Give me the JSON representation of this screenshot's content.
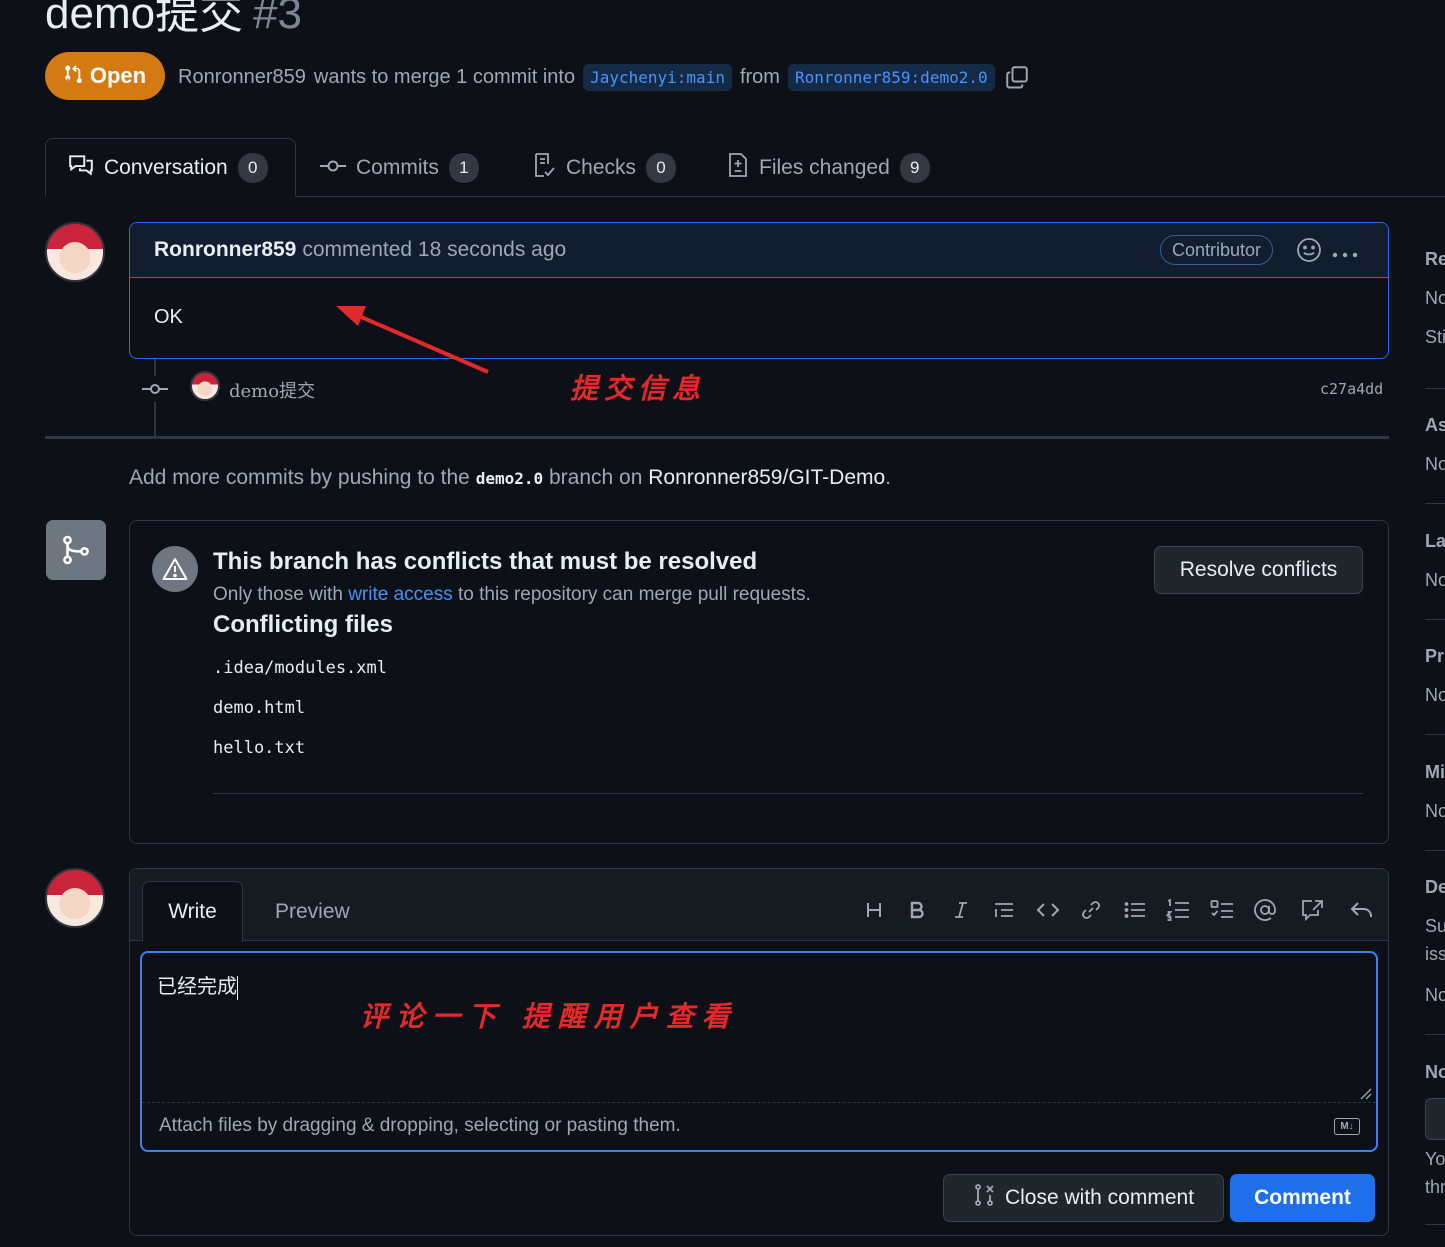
{
  "pr": {
    "title": "demo提交",
    "number": "#3",
    "status": "Open",
    "author": "Ronronner859",
    "merge_text_1": "wants to merge 1 commit into",
    "base_branch": "Jaychenyi:main",
    "from_text": "from",
    "head_branch": "Ronronner859:demo2.0"
  },
  "tabs": [
    {
      "label": "Conversation",
      "count": "0"
    },
    {
      "label": "Commits",
      "count": "1"
    },
    {
      "label": "Checks",
      "count": "0"
    },
    {
      "label": "Files changed",
      "count": "9"
    }
  ],
  "comment": {
    "author": "Ronronner859",
    "meta": "commented 18 seconds ago",
    "badge": "Contributor",
    "body": "OK"
  },
  "commit": {
    "message": "demo提交",
    "sha": "c27a4dd"
  },
  "annotations": {
    "commit_info": "提交信息",
    "comment_hint": "评论一下 提醒用户查看"
  },
  "add_commits": {
    "prefix": "Add more commits by pushing to the",
    "branch": "demo2.0",
    "middle": "branch on",
    "repo": "Ronronner859/GIT-Demo",
    "suffix": "."
  },
  "merge": {
    "title": "This branch has conflicts that must be resolved",
    "sub_prefix": "Only those with",
    "sub_link": "write access",
    "sub_suffix": "to this repository can merge pull requests.",
    "files_title": "Conflicting files",
    "files": [
      ".idea/modules.xml",
      "demo.html",
      "hello.txt"
    ],
    "resolve_button": "Resolve conflicts"
  },
  "composer": {
    "write_tab": "Write",
    "preview_tab": "Preview",
    "text": "已经完成",
    "attach_hint": "Attach files by dragging & dropping, selecting or pasting them.",
    "close_button": "Close with comment",
    "comment_button": "Comment"
  },
  "sidebar": {
    "items": [
      "Re",
      "No",
      "Sti",
      "As",
      "No",
      "La",
      "No",
      "Pr",
      "No",
      "Mi",
      "No",
      "De",
      "Su",
      "iss",
      "No",
      "No",
      "Yo",
      "thr"
    ]
  },
  "colors": {
    "open_badge": "#d47a13",
    "accent_blue": "#1f6feb",
    "annotation_red": "#e22a2a"
  }
}
